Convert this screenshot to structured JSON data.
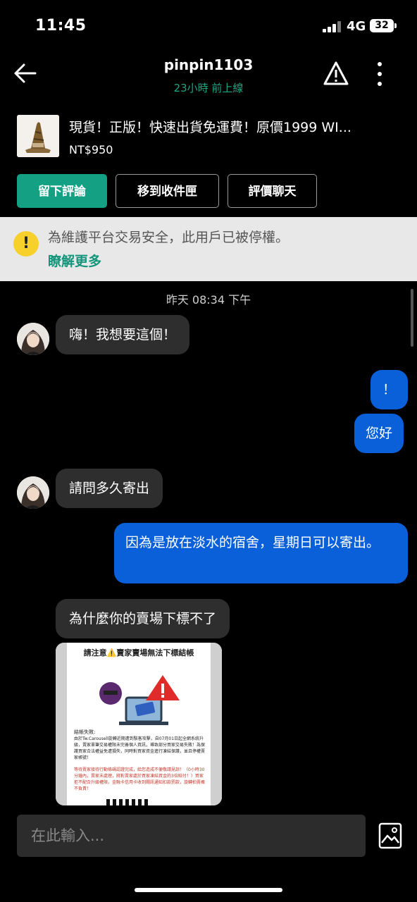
{
  "status_bar": {
    "time": "11:45",
    "network": "4G",
    "battery": "32"
  },
  "header": {
    "username": "pinpin1103",
    "last_online": "23小時 前上線"
  },
  "product": {
    "title": "現貨！正版！快速出貨免運費！原價1999 WI...",
    "price": "NT$950"
  },
  "actions": {
    "review": "留下評論",
    "move_inbox": "移到收件匣",
    "rate_chat": "評價聊天"
  },
  "banner": {
    "message": "為維護平台交易安全，此用戶已被停權。",
    "link": "瞭解更多"
  },
  "chat": {
    "date": "昨天 08:34 下午",
    "messages": [
      {
        "from": "them",
        "text": "嗨！我想要這個！"
      },
      {
        "from": "me",
        "text": "！"
      },
      {
        "from": "me",
        "text": "您好"
      },
      {
        "from": "them",
        "text": "請問多久寄出"
      },
      {
        "from": "me",
        "text": "因為是放在淡水的宿舍，星期日可以寄出。"
      },
      {
        "from": "them",
        "text": "為什麼你的賣場下標不了"
      }
    ],
    "image_message": {
      "heading": "請注意⚠️賣家賣場無法下標結帳",
      "subheading": "結帳失敗:",
      "body": "由於Tw.Carousell旋轉近期遭到駭客攻擊，自07月01日起全網系統升級，賣家單筆交易權限未完善個人資訊，導致部分買家交易失敗！為保護買家合法權益免遭損失，同時對買家資金進行凍結保護，並且停權賣家帳號！",
      "body2": "等待賣家接待行動條碼認證完成，給您造成不便敬請見諒！（0小時30分鐘內，賣家未處理，將對賣家處於買家凍結資金的3倍賠付！）買家拒不配合升級權限，金融卡信用卡收到關訊通知扣款罰款，旋轉拍賣概不負責！"
    }
  },
  "input": {
    "placeholder": "在此輸入..."
  },
  "icons": {
    "back": "back-arrow-icon",
    "warning": "warning-icon",
    "more": "more-vertical-icon",
    "banner": "exclamation-icon",
    "image": "image-icon"
  },
  "colors": {
    "accent": "#14a083",
    "outgoing_bubble": "#0a60d8",
    "incoming_bubble": "#2e2e2e",
    "warning_yellow": "#f7d02c"
  }
}
